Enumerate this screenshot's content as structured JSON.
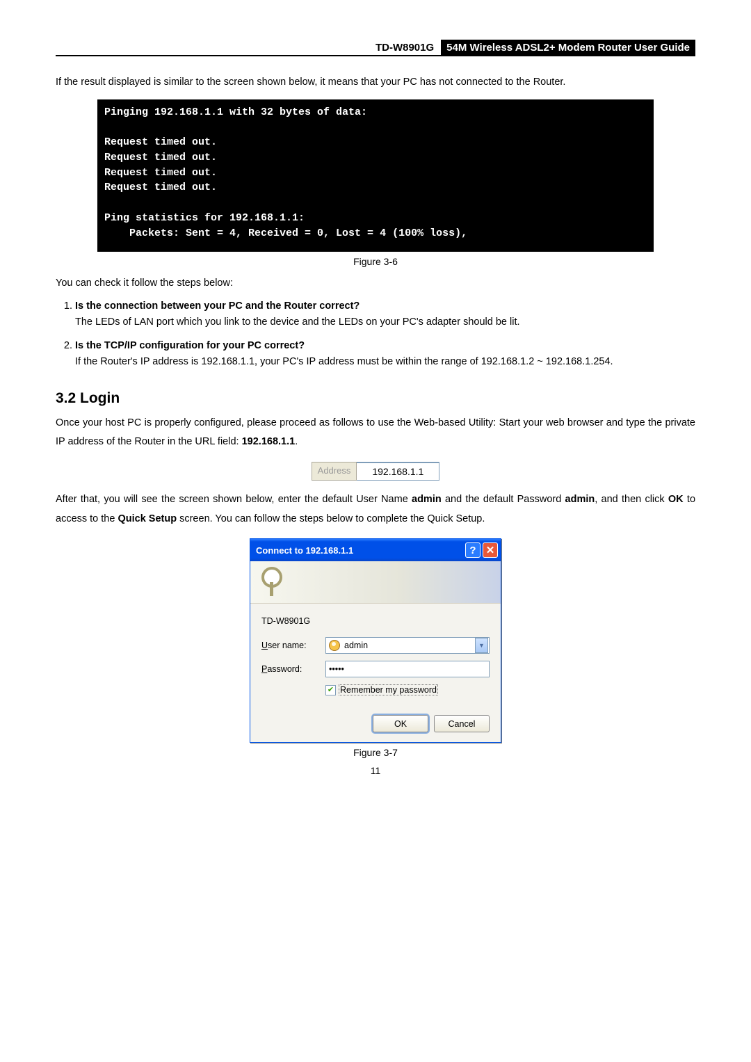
{
  "header": {
    "model": "TD-W8901G",
    "title": "54M Wireless ADSL2+ Modem Router User Guide"
  },
  "intro_text": "If the result displayed is similar to the screen shown below, it means that your PC has not connected to the Router.",
  "terminal_output": "Pinging 192.168.1.1 with 32 bytes of data:\n\nRequest timed out.\nRequest timed out.\nRequest timed out.\nRequest timed out.\n\nPing statistics for 192.168.1.1:\n    Packets: Sent = 4, Received = 0, Lost = 4 (100% loss),",
  "figure_caption_1": "Figure 3-6",
  "check_intro": "You can check it follow the steps below:",
  "steps": [
    {
      "q": "Is the connection between your PC and the Router correct?",
      "a": "The LEDs of LAN port which you link to the device and the LEDs on your PC's adapter should be lit."
    },
    {
      "q": "Is the TCP/IP configuration for your PC correct?",
      "a": "If the Router's IP address is 192.168.1.1, your PC's IP address must be within the range of 192.168.1.2 ~ 192.168.1.254."
    }
  ],
  "section_heading": "3.2   Login",
  "login_para": "Once your host PC is properly configured, please proceed as follows to use the Web-based Utility: Start your web browser and type the private IP address of the Router in the URL field: ",
  "login_ip_bold": "192.168.1.1",
  "address_bar": {
    "label": "Address",
    "value": "192.168.1.1"
  },
  "after_url_parts": {
    "p1": "After that, you will see the screen shown below, enter the default User Name ",
    "b1": "admin",
    "p2": " and the default Password ",
    "b2": "admin",
    "p3": ", and then click ",
    "b3": "OK",
    "p4": " to access to the ",
    "b4": "Quick Setup",
    "p5": " screen. You can follow the steps below to complete the Quick Setup."
  },
  "dialog": {
    "title": "Connect to 192.168.1.1",
    "realm": "TD-W8901G",
    "user_label": "User name:",
    "user_value": "admin",
    "pass_label": "Password:",
    "pass_value": "•••••",
    "remember": "Remember my password",
    "ok": "OK",
    "cancel": "Cancel"
  },
  "figure_caption_2": "Figure 3-7",
  "page_number": "11"
}
